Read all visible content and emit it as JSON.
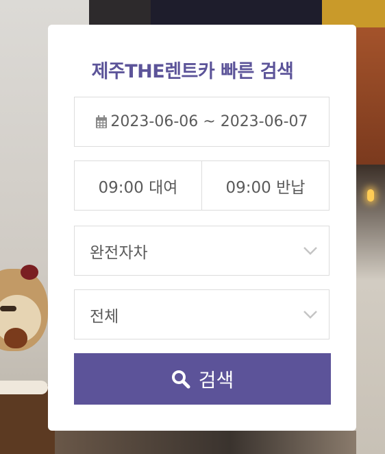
{
  "title": "제주THE렌트카 빠른 검색",
  "date_range": "2023-06-06 ~ 2023-06-07",
  "pickup_time": "09:00 대여",
  "return_time": "09:00 반납",
  "insurance_select": {
    "selected": "완전자차"
  },
  "car_type_select": {
    "selected": "전체"
  },
  "search_button_label": "검색",
  "colors": {
    "accent": "#5c5399",
    "title": "#5c5499",
    "border": "#dcdcdc"
  },
  "icons": {
    "date": "calendar-icon",
    "select": "chevron-down-icon",
    "search": "search-icon"
  }
}
